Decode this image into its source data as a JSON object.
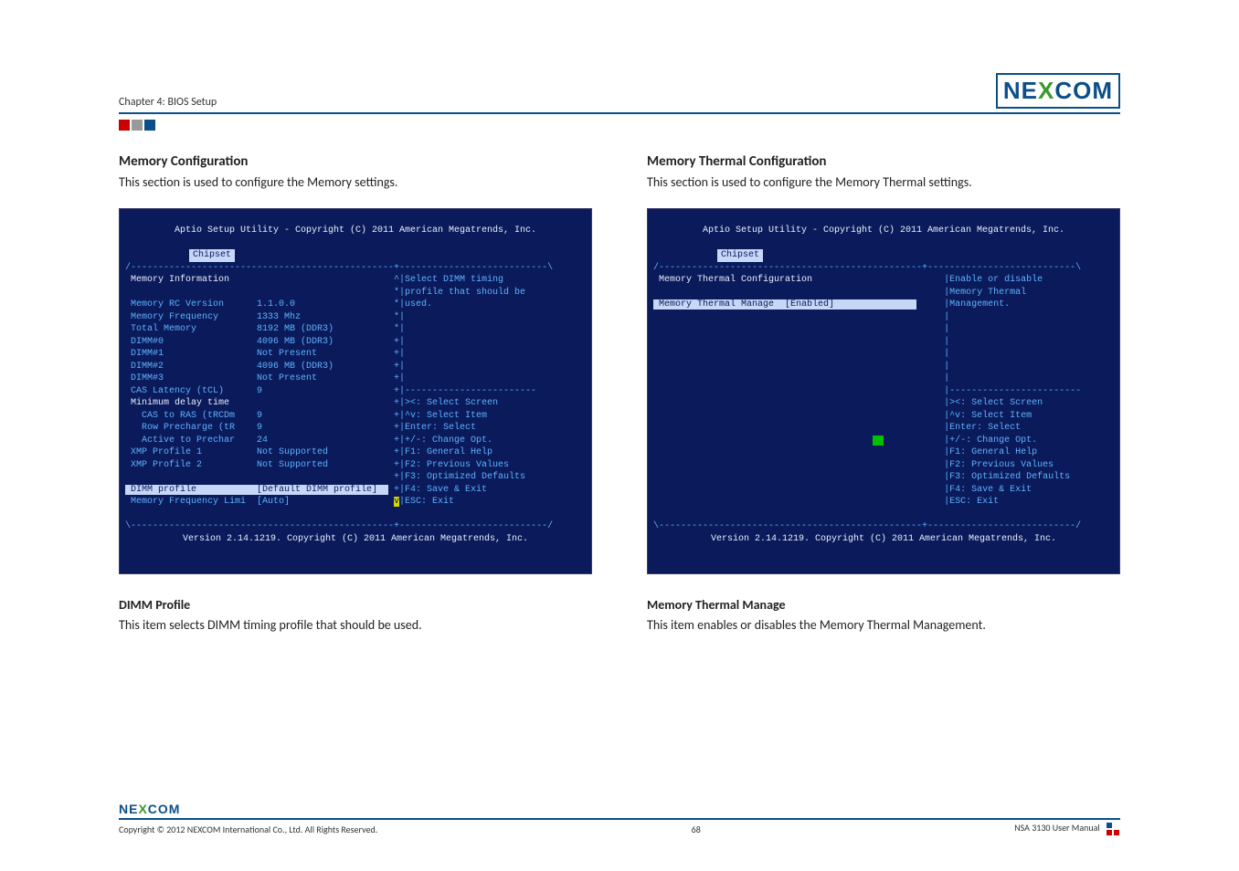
{
  "header": {
    "chapter": "Chapter 4: BIOS Setup",
    "brand_left": "NE",
    "brand_mid": "X",
    "brand_right": "COM"
  },
  "left": {
    "title": "Memory Configuration",
    "desc": "This section is used to configure the Memory settings.",
    "bios": {
      "top": "Aptio Setup Utility - Copyright (C) 2011 American Megatrends, Inc.",
      "tab": "Chipset",
      "rows_left": [
        {
          "label": "Memory Information",
          "value": "",
          "cls": "white"
        },
        {
          "label": "",
          "value": ""
        },
        {
          "label": "Memory RC Version",
          "value": "1.1.0.0",
          "cls": "dim"
        },
        {
          "label": "Memory Frequency",
          "value": "1333 Mhz",
          "cls": "dim"
        },
        {
          "label": "Total Memory",
          "value": "8192 MB (DDR3)",
          "cls": "dim"
        },
        {
          "label": "DIMM#0",
          "value": "4096 MB (DDR3)",
          "cls": "dim"
        },
        {
          "label": "DIMM#1",
          "value": "Not Present",
          "cls": "dim"
        },
        {
          "label": "DIMM#2",
          "value": "4096 MB (DDR3)",
          "cls": "dim"
        },
        {
          "label": "DIMM#3",
          "value": "Not Present",
          "cls": "dim"
        },
        {
          "label": "CAS Latency (tCL)",
          "value": "9",
          "cls": "dim"
        },
        {
          "label": "Minimum delay time",
          "value": "",
          "cls": "white"
        },
        {
          "label": "  CAS to RAS (tRCDm",
          "value": "9",
          "cls": "dim"
        },
        {
          "label": "  Row Precharge (tR",
          "value": "9",
          "cls": "dim"
        },
        {
          "label": "  Active to Prechar",
          "value": "24",
          "cls": "dim"
        },
        {
          "label": "XMP Profile 1",
          "value": "Not Supported",
          "cls": "dim"
        },
        {
          "label": "XMP Profile 2",
          "value": "Not Supported",
          "cls": "dim"
        },
        {
          "label": "",
          "value": ""
        },
        {
          "label": "DIMM profile",
          "value": "[Default DIMM profile]",
          "cls": "sel"
        },
        {
          "label": "Memory Frequency Limi",
          "value": "[Auto]",
          "cls": "dim"
        }
      ],
      "rows_right": [
        "^|Select DIMM timing",
        "*|profile that should be",
        "*|used.",
        "*|",
        "*|",
        "+|",
        "+|",
        "+|",
        "+|",
        "+|------------------------",
        "+|><: Select Screen",
        "+|^v: Select Item",
        "+|Enter: Select",
        "+|+/-: Change Opt.",
        "+|F1: General Help",
        "+|F2: Previous Values",
        "+|F3: Optimized Defaults",
        "+|F4: Save & Exit",
        "v|ESC: Exit"
      ],
      "bottom": "Version 2.14.1219. Copyright (C) 2011 American Megatrends, Inc."
    },
    "sub_title": "DIMM Profile",
    "sub_desc": "This item selects DIMM timing profile that should be used."
  },
  "right": {
    "title": "Memory Thermal Configuration",
    "desc": "This section is used to configure the Memory Thermal settings.",
    "bios": {
      "top": "Aptio Setup Utility - Copyright (C) 2011 American Megatrends, Inc.",
      "tab": "Chipset",
      "rows_left": [
        {
          "label": "Memory Thermal Configuration",
          "value": "",
          "cls": "white"
        },
        {
          "label": "",
          "value": ""
        },
        {
          "label": "Memory Thermal Manage",
          "value": "[Enabled]",
          "cls": "sel"
        },
        {
          "label": "",
          "value": ""
        },
        {
          "label": "",
          "value": ""
        },
        {
          "label": "",
          "value": ""
        },
        {
          "label": "",
          "value": ""
        },
        {
          "label": "",
          "value": ""
        },
        {
          "label": "",
          "value": ""
        },
        {
          "label": "",
          "value": ""
        },
        {
          "label": "",
          "value": ""
        },
        {
          "label": "",
          "value": ""
        },
        {
          "label": "",
          "value": ""
        },
        {
          "label": "",
          "value": "",
          "pad": true
        },
        {
          "label": "",
          "value": ""
        },
        {
          "label": "",
          "value": ""
        },
        {
          "label": "",
          "value": ""
        },
        {
          "label": "",
          "value": ""
        },
        {
          "label": "",
          "value": ""
        }
      ],
      "rows_right": [
        "|Enable or disable",
        "|Memory Thermal",
        "|Management.",
        "|",
        "|",
        "|",
        "|",
        "|",
        "|",
        "|------------------------",
        "|><: Select Screen",
        "|^v: Select Item",
        "|Enter: Select",
        "|+/-: Change Opt.",
        "|F1: General Help",
        "|F2: Previous Values",
        "|F3: Optimized Defaults",
        "|F4: Save & Exit",
        "|ESC: Exit"
      ],
      "bottom": "Version 2.14.1219. Copyright (C) 2011 American Megatrends, Inc."
    },
    "sub_title": "Memory Thermal Manage",
    "sub_desc": "This item enables or disables the Memory Thermal Management."
  },
  "footer": {
    "brand_left": "NE",
    "brand_mid": "X",
    "brand_right": "COM",
    "copyright": "Copyright © 2012 NEXCOM International Co., Ltd. All Rights Reserved.",
    "page": "68",
    "manual": "NSA 3130 User Manual"
  }
}
